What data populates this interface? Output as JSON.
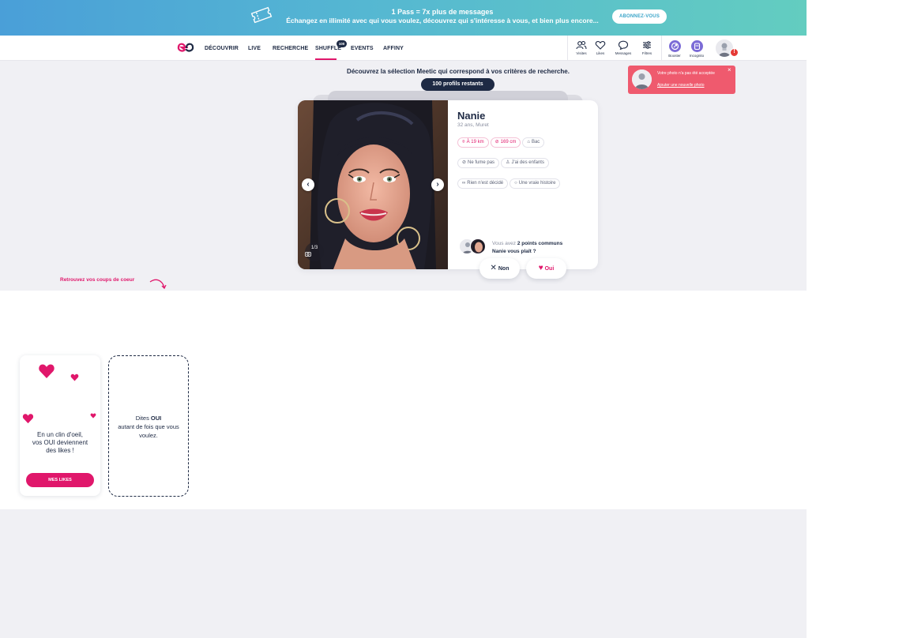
{
  "promo": {
    "headline": "1 Pass = 7x plus de messages",
    "subline": "Échangez en illimité avec qui vous voulez, découvrez qui s'intéresse à vous, et bien plus encore...",
    "cta": "ABONNEZ-VOUS",
    "icon": "ticket-icon"
  },
  "nav": {
    "items": [
      "DÉCOUVRIR",
      "LIVE",
      "RECHERCHE",
      "SHUFFLE",
      "EVENTS",
      "AFFINY"
    ],
    "active": "SHUFFLE",
    "shuffle_badge": "100",
    "icons": [
      {
        "label": "Visites",
        "icon": "visits-icon"
      },
      {
        "label": "Likes",
        "icon": "heart-icon"
      },
      {
        "label": "Messages",
        "icon": "message-icon"
      },
      {
        "label": "Filtres",
        "icon": "filter-icon"
      }
    ],
    "boost": [
      {
        "label": "Booster",
        "icon": "boost-icon"
      },
      {
        "label": "Incognito",
        "icon": "incognito-icon"
      }
    ],
    "alert": "!",
    "accent_color": "#e0176b"
  },
  "discover": {
    "intro": "Découvrez la sélection Meetic qui correspond à vos critères de recherche.",
    "remaining": "100 profils restants"
  },
  "profile": {
    "name": "Nanie",
    "subtitle": "32 ans, Muret",
    "photo_counter": "1/3",
    "chips": [
      {
        "label": "À 19 km",
        "icon": "location-icon",
        "highlight": true
      },
      {
        "label": "169 cm",
        "icon": "ruler-icon",
        "highlight": true
      },
      {
        "label": "Bac",
        "icon": "graduation-icon",
        "highlight": false
      },
      {
        "label": "Ne fume pas",
        "icon": "no-smoking-icon",
        "highlight": false
      },
      {
        "label": "J'ai des enfants",
        "icon": "children-icon",
        "highlight": false
      },
      {
        "label": "Rien n'est décidé",
        "icon": "link-icon",
        "highlight": false
      },
      {
        "label": "Une vraie histoire",
        "icon": "search-icon",
        "highlight": false
      }
    ],
    "common_prefix": "Vous avez",
    "common_count": "2 points communs",
    "common_question": "Nanie vous plaît ?"
  },
  "actions": {
    "no": "Non",
    "yes": "Oui"
  },
  "toast": {
    "message": "Votre photo n'a pas été acceptée",
    "link": "Ajouter une nouvelle photo",
    "close": "×"
  },
  "coups": {
    "label": "Retrouvez vos coups de coeur"
  },
  "likes_card": {
    "message_line1": "En un clin d'oeil,",
    "message_line2": "vos OUI deviennent",
    "message_line3": "des likes !",
    "button": "MES LIKES"
  },
  "dashed_card": {
    "prefix": "Dites ",
    "bold": "OUI",
    "rest": "autant de fois que vous voulez."
  }
}
